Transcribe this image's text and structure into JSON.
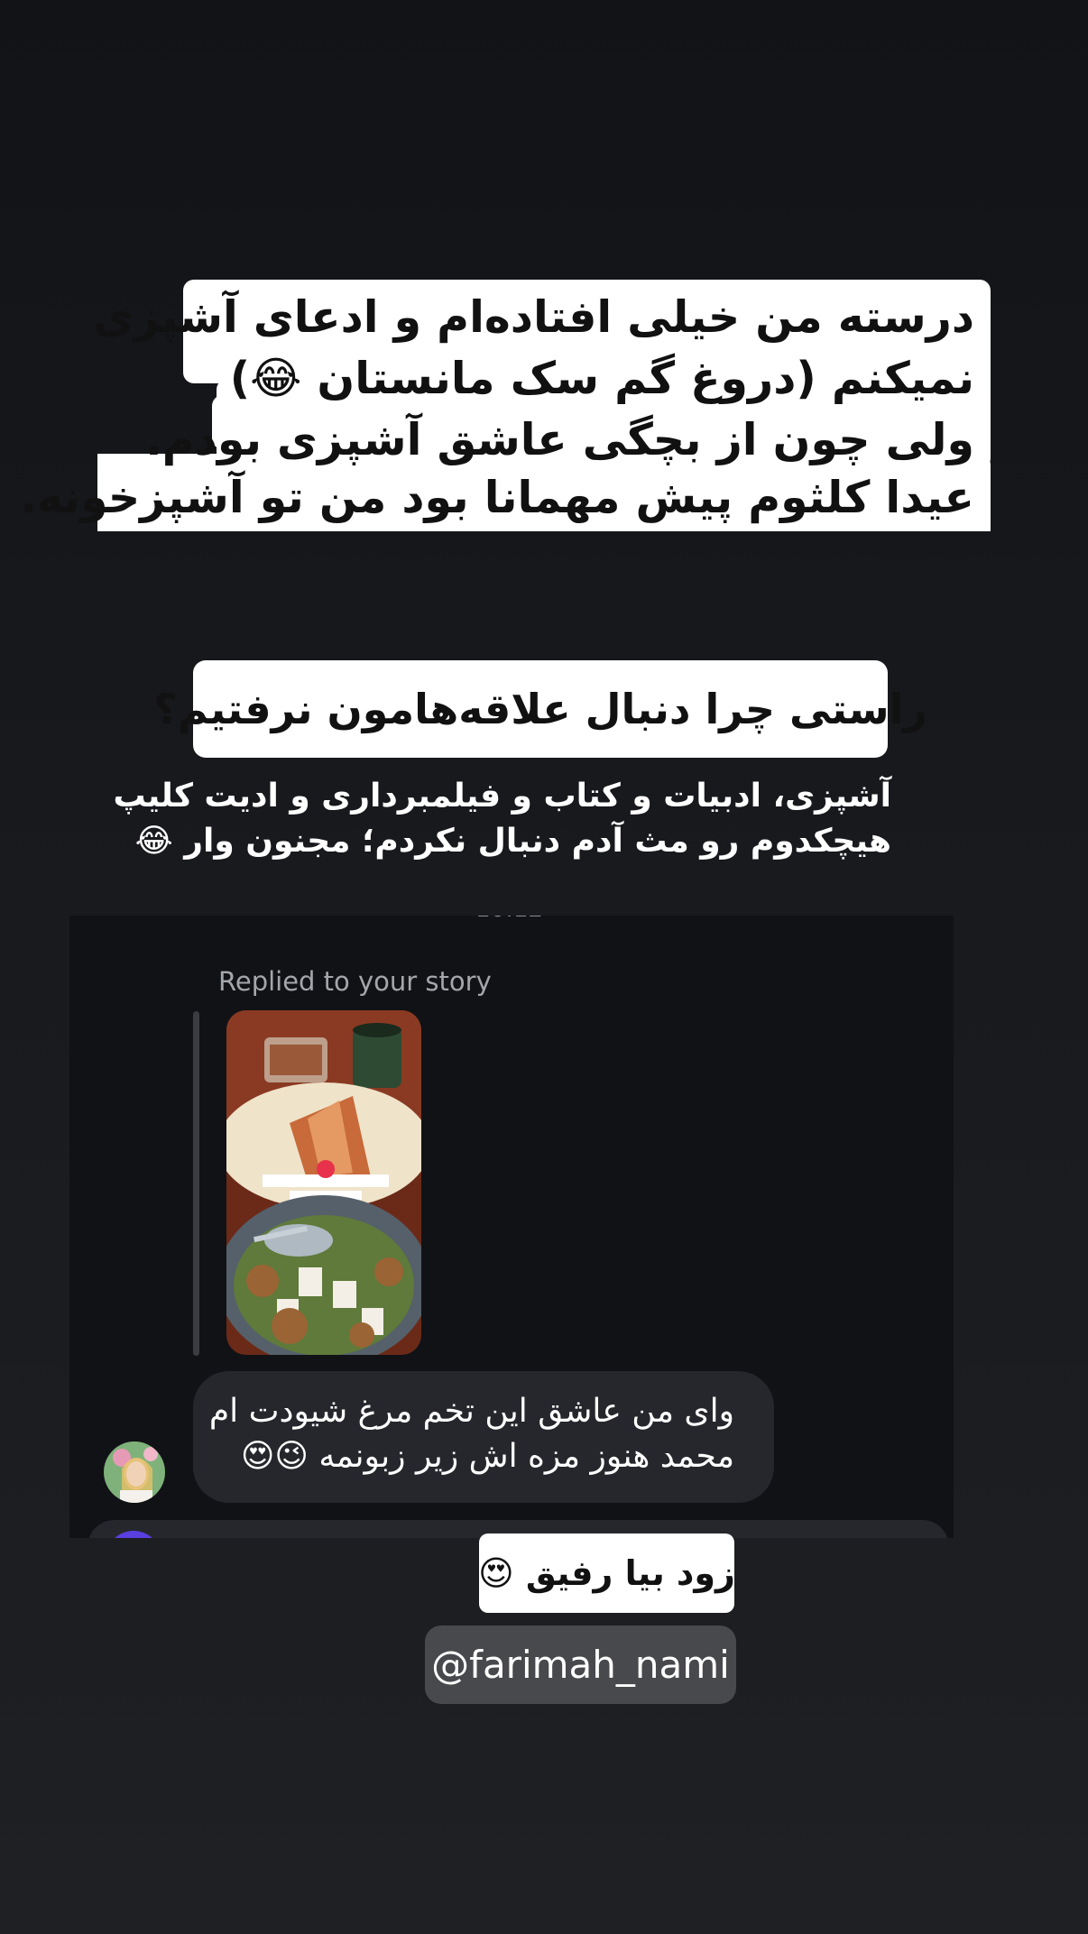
{
  "caption": {
    "lines": [
      "درسته من خیلی افتاده‌ام و ادعای آشپزی",
      "نمیکنم (دروغ گم سک مانستان 😂)",
      "ولی چون از بچگی عاشق آشپزی بودم.",
      "عیدا کلثوم پیش مهمانا بود من تو آشپزخونه."
    ]
  },
  "question": {
    "text": "راستی چرا دنبال علاقه‌هامون نرفتیم؟"
  },
  "subtitle": {
    "line1": "آشپزی، ادبیات و کتاب و فیلمبرداری و ادیت کلیپ",
    "line2": "هیچکدوم رو مث آدم دنبال نکردم؛ مجنون وار 😂"
  },
  "dm": {
    "time": "10:12",
    "replied_label": "Replied to your story",
    "message_line1": "وای من عاشق این تخم مرغ شیودت ام",
    "message_line2": "محمد هنوز مزه اش زیر زبونمه 😉😍",
    "avatar_icon": "user-avatar",
    "story_thumbnail_icon": "food-photo"
  },
  "sticker": {
    "text": "زود بیا رفیق 😍"
  },
  "mention": {
    "text": "@farimah_nami"
  }
}
